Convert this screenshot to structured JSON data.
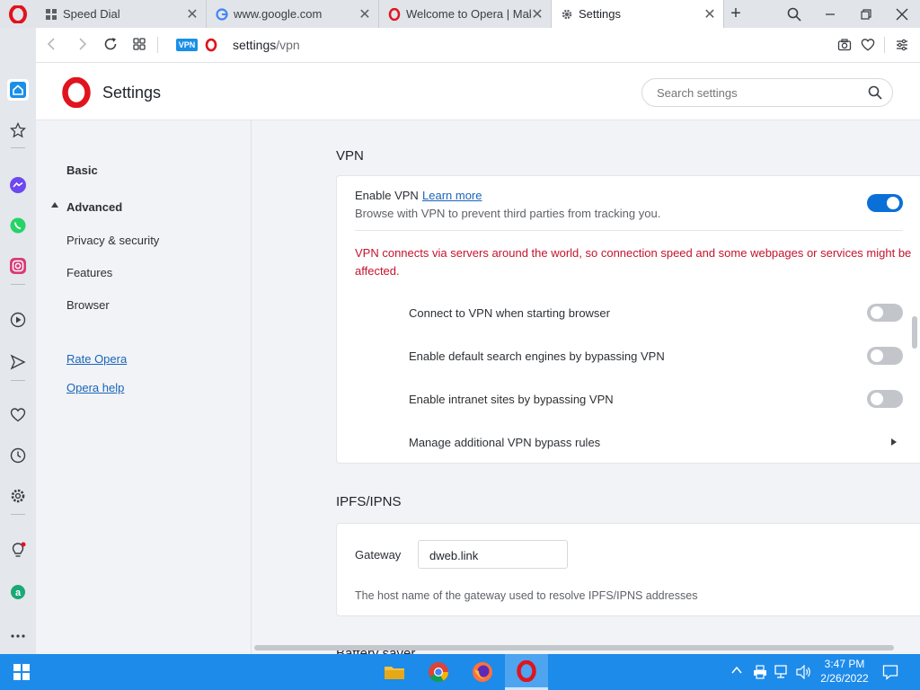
{
  "tabs": [
    {
      "label": "Speed Dial",
      "icon": "speed-dial-icon"
    },
    {
      "label": "www.google.com",
      "icon": "google-icon"
    },
    {
      "label": "Welcome to Opera | Make",
      "icon": "opera-icon"
    },
    {
      "label": "Settings",
      "icon": "gear-icon",
      "active": true
    }
  ],
  "address": {
    "vpn_badge": "VPN",
    "url_main": "settings",
    "url_path": "/vpn"
  },
  "header": {
    "title": "Settings",
    "search_placeholder": "Search settings"
  },
  "nav": {
    "basic": "Basic",
    "advanced": "Advanced",
    "items": [
      "Privacy & security",
      "Features",
      "Browser"
    ],
    "links": [
      "Rate Opera",
      "Opera help"
    ]
  },
  "vpn": {
    "section_title": "VPN",
    "enable_label": "Enable VPN",
    "learn_more": "Learn more",
    "enable_desc": "Browse with VPN to prevent third parties from tracking you.",
    "enabled": true,
    "warning": "VPN connects via servers around the world, so connection speed and some webpages or services might be affected.",
    "options": [
      {
        "label": "Connect to VPN when starting browser",
        "on": false
      },
      {
        "label": "Enable default search engines by bypassing VPN",
        "on": false
      },
      {
        "label": "Enable intranet sites by bypassing VPN",
        "on": false
      }
    ],
    "manage_label": "Manage additional VPN bypass rules"
  },
  "ipfs": {
    "section_title": "IPFS/IPNS",
    "gateway_label": "Gateway",
    "gateway_value": "dweb.link",
    "gateway_desc": "The host name of the gateway used to resolve IPFS/IPNS addresses"
  },
  "next_section_partial": "Battery saver",
  "taskbar": {
    "time": "3:47 PM",
    "date": "2/26/2022"
  },
  "colors": {
    "accent": "#0a70d8",
    "warning": "#c4142d",
    "opera_red": "#e0141e",
    "taskbar": "#1d8bea"
  }
}
